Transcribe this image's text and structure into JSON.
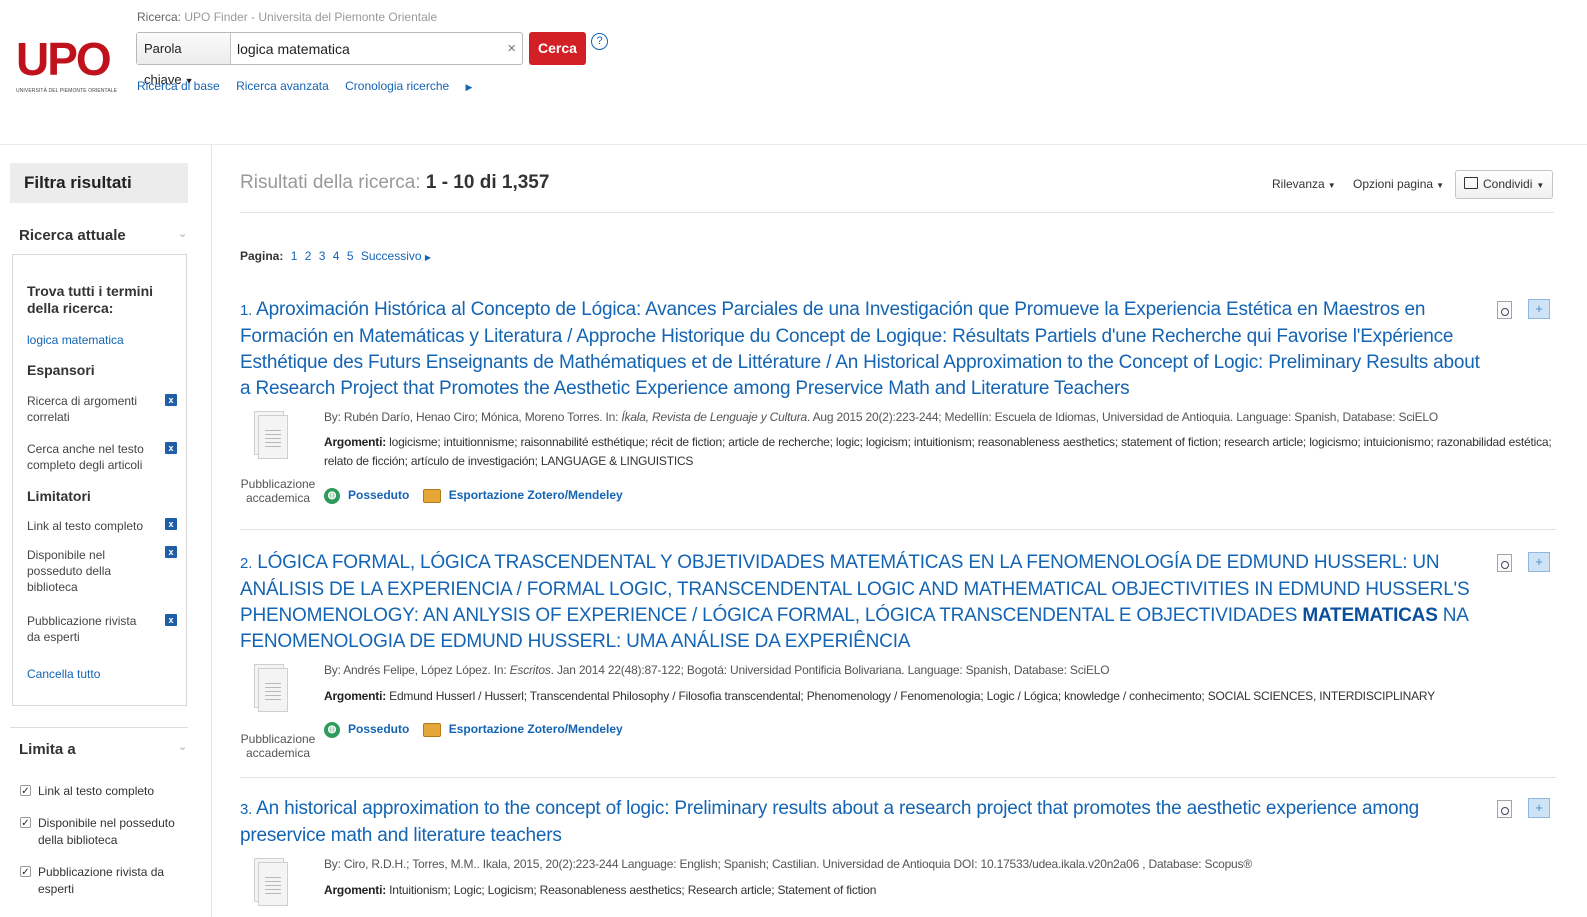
{
  "header": {
    "logo_text": "UPO",
    "logo_sub": "UNIVERSITÀ DEL PIEMONTE ORIENTALE",
    "search_context_label": "Ricerca:",
    "search_context_value": "UPO Finder - Universita del Piemonte Orientale",
    "field_select": "Parola chiave",
    "query": "logica matematica",
    "clear_label": "×",
    "search_button": "Cerca",
    "help_label": "?",
    "links": {
      "basic": "Ricerca di base",
      "advanced": "Ricerca avanzata",
      "history": "Cronologia ricerche"
    }
  },
  "sidebar": {
    "title": "Filtra risultati",
    "current_search_heading": "Ricerca attuale",
    "find_all_terms_heading": "Trova tutti i termini della ricerca:",
    "find_all_terms_value": "logica matematica",
    "expanders_heading": "Espansori",
    "expanders": [
      "Ricerca di argomenti correlati",
      "Cerca anche nel testo completo degli articoli"
    ],
    "limiters_heading": "Limitatori",
    "limiters": [
      "Link al testo completo",
      "Disponibile nel posseduto della biblioteca",
      "Pubblicazione rivista da esperti"
    ],
    "remove_label": "x",
    "clear_all": "Cancella tutto",
    "limit_to_heading": "Limita a",
    "limit_to_options": [
      {
        "label": "Link al testo completo",
        "checked": true
      },
      {
        "label": "Disponibile nel posseduto della biblioteca",
        "checked": true
      },
      {
        "label": "Pubblicazione rivista da esperti",
        "checked": true
      }
    ]
  },
  "main": {
    "results_label": "Risultati della ricerca:",
    "results_range": "1 - 10 di 1,357",
    "sort": "Rilevanza",
    "page_options": "Opzioni pagina",
    "share": "Condividi",
    "pagination_label": "Pagina:",
    "pages": [
      "1",
      "2",
      "3",
      "4",
      "5"
    ],
    "next": "Successivo",
    "held_label": "Posseduto",
    "export_label": "Esportazione Zotero/Mendeley",
    "subjects_label": "Argomenti:",
    "results": [
      {
        "number": "1.",
        "title": "Aproximación Histórica al Concepto de Lógica: Avances Parciales de una Investigación que Promueve la Experiencia Estética en Maestros en Formación en Matemáticas y Literatura / Approche Historique du Concept de Logique: Résultats Partiels d'une Recherche qui Favorise l'Expérience Esthétique des Futurs Enseignants de Mathématiques et de Littérature / An Historical Approximation to the Concept of Logic: Preliminary Results about a Research Project that Promotes the Aesthetic Experience among Preservice Math and Literature Teachers",
        "byline_pre": "By: Rubén Darío, Henao Ciro; Mónica, Moreno Torres. In: ",
        "source": "Íkala, Revista de Lenguaje y Cultura",
        "byline_post": ". Aug 2015 20(2):223-244; Medellín: Escuela de Idiomas, Universidad de Antioquia. Language: Spanish, Database: SciELO",
        "subjects": "logicisme; intuitionnisme; raisonnabilité esthétique; récit de fiction; article de recherche; logic; logicism; intuitionism; reasonableness aesthetics; statement of fiction; research article; logicismo; intuicionismo; razonabilidad estética; relato de ficción; artículo de investigación; LANGUAGE & LINGUISTICS",
        "type": "Pubblicazione accademica"
      },
      {
        "number": "2.",
        "title_pre": "LÓGICA FORMAL, LÓGICA TRASCENDENTAL Y OBJETIVIDADES MATEMÁTICAS EN LA FENOMENOLOGÍA DE EDMUND HUSSERL: UN ANÁLISIS DE LA EXPERIENCIA / FORMAL LOGIC, TRANSCENDENTAL LOGIC AND MATHEMATICAL OBJECTIVITIES IN EDMUND HUSSERL'S PHENOMENOLOGY: AN ANLYSIS OF EXPERIENCE / LÓGICA FORMAL, LÓGICA TRANSCENDENTAL E OBJECTIVIDADES ",
        "title_highlight": "MATEMATICAS",
        "title_post": " NA FENOMENOLOGIA DE EDMUND HUSSERL: UMA ANÁLISE DA EXPERIÊNCIA",
        "byline_pre": "By: Andrés Felipe, López López. In: ",
        "source": "Escritos",
        "byline_post": ". Jan 2014 22(48):87-122; Bogotá: Universidad Pontificia Bolivariana. Language: Spanish, Database: SciELO",
        "subjects": "Edmund Husserl / Husserl; Transcendental Philosophy / Filosofia transcendental; Phenomenology / Fenomenologia; Logic / Lógica; knowledge / conhecimento; SOCIAL SCIENCES, INTERDISCIPLINARY",
        "type": "Pubblicazione accademica"
      },
      {
        "number": "3.",
        "title": "An historical approximation to the concept of logic: Preliminary results about a research project that promotes the aesthetic experience among preservice math and literature teachers",
        "byline": "By: Ciro, R.D.H.; Torres, M.M.. Ikala, 2015, 20(2):223-244 Language: English; Spanish; Castilian. Universidad de Antioquia DOI: 10.17533/udea.ikala.v20n2a06 , Database: Scopus®",
        "subjects": "Intuitionism; Logic; Logicism; Reasonableness aesthetics; Research article; Statement of fiction"
      }
    ]
  },
  "colors": {
    "brand_red": "#d31f26",
    "link_blue": "#1464b4",
    "remove_blue": "#1f5fa8",
    "held_green": "#2e9b5c"
  }
}
